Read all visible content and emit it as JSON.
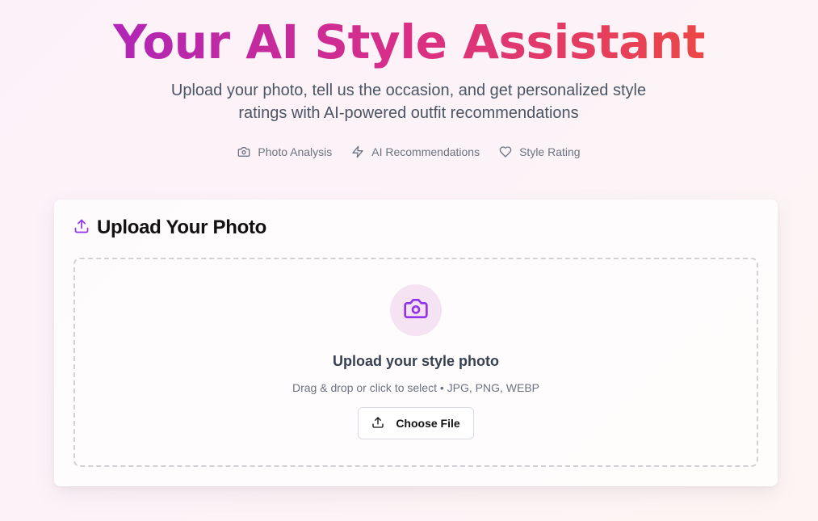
{
  "hero": {
    "title": "Your AI Style Assistant",
    "subtitle": "Upload your photo, tell us the occasion, and get personalized style ratings with AI-powered outfit recommendations",
    "features": [
      {
        "icon": "camera-icon",
        "label": "Photo Analysis"
      },
      {
        "icon": "lightning-icon",
        "label": "AI Recommendations"
      },
      {
        "icon": "heart-icon",
        "label": "Style Rating"
      }
    ]
  },
  "upload": {
    "icon": "upload-icon",
    "title": "Upload Your Photo",
    "dropzone": {
      "icon": "camera-icon",
      "title": "Upload your style photo",
      "hint": "Drag & drop or click to select • JPG, PNG, WEBP",
      "button_icon": "upload-icon",
      "button_label": "Choose File"
    }
  },
  "colors": {
    "title_gradient_start": "#b026b6",
    "title_gradient_mid": "#d92f86",
    "title_gradient_end": "#ec4746",
    "accent_purple": "#9333ea",
    "camera_circle_bg": "#f5e3f3",
    "muted_text": "#6b7280"
  }
}
